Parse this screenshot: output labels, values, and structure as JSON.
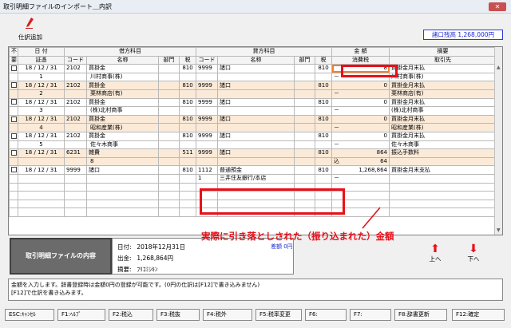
{
  "window": {
    "title": "取引明細ファイルのインポート＿内訳",
    "close_label": "✕"
  },
  "toolbar": {
    "add_label": "仕訳追加"
  },
  "balance": {
    "text": "諸口残高 1,268,000円"
  },
  "grid": {
    "header_row1": {
      "fu": "不",
      "date": "日 付",
      "debit": "借方科目",
      "credit": "貸方科目",
      "amount": "金 額",
      "memo": "摘要"
    },
    "header_row2": {
      "yo": "要",
      "voucher": "証憑",
      "d_code": "コード",
      "d_name": "名称",
      "d_dept": "部門",
      "d_tax": "税",
      "c_code": "コード",
      "c_name": "名称",
      "c_dept": "部門",
      "c_tax": "税",
      "tax_amt": "消費税",
      "partner": "取引先"
    },
    "records": [
      {
        "date": "18 / 12 / 31",
        "d_code": "2102",
        "d_name": "買掛金",
        "d_tax": "810",
        "c_code": "9999",
        "c_name": "諸口",
        "c_tax": "810",
        "amount": "8",
        "memo": "買掛金月末払",
        "voucher": "1",
        "d_sub": "川村商事(株)",
        "tax_flag": "－",
        "tax_amt": "",
        "partner": "川村商事(株)"
      },
      {
        "date": "18 / 12 / 31",
        "d_code": "2102",
        "d_name": "買掛金",
        "d_tax": "810",
        "c_code": "9999",
        "c_name": "諸口",
        "c_tax": "810",
        "amount": "0",
        "memo": "買掛金月末払",
        "voucher": "2",
        "d_sub": "栗林商店(有)",
        "tax_flag": "－",
        "tax_amt": "",
        "partner": "栗林商店(有)"
      },
      {
        "date": "18 / 12 / 31",
        "d_code": "2102",
        "d_name": "買掛金",
        "d_tax": "810",
        "c_code": "9999",
        "c_name": "諸口",
        "c_tax": "810",
        "amount": "0",
        "memo": "買掛金月末払",
        "voucher": "3",
        "d_sub": "(株)北村商事",
        "tax_flag": "－",
        "tax_amt": "",
        "partner": "(株)北村商事"
      },
      {
        "date": "18 / 12 / 31",
        "d_code": "2102",
        "d_name": "買掛金",
        "d_tax": "810",
        "c_code": "9999",
        "c_name": "諸口",
        "c_tax": "810",
        "amount": "0",
        "memo": "買掛金月末払",
        "voucher": "4",
        "d_sub": "昭和産業(株)",
        "tax_flag": "－",
        "tax_amt": "",
        "partner": "昭和産業(株)"
      },
      {
        "date": "18 / 12 / 31",
        "d_code": "2102",
        "d_name": "買掛金",
        "d_tax": "810",
        "c_code": "9999",
        "c_name": "諸口",
        "c_tax": "810",
        "amount": "0",
        "memo": "買掛金月末払",
        "voucher": "5",
        "d_sub": "佐々木商事",
        "tax_flag": "－",
        "tax_amt": "",
        "partner": "佐々木商事"
      },
      {
        "date": "18 / 12 / 31",
        "d_code": "6231",
        "d_name": "雑費",
        "d_tax": "511",
        "c_code": "9999",
        "c_name": "諸口",
        "c_tax": "810",
        "amount": "864",
        "memo": "振込手数料",
        "voucher": "",
        "d_sub": "8",
        "tax_flag": "込",
        "tax_amt": "64",
        "partner": ""
      },
      {
        "date": "18 / 12 / 31",
        "d_code": "9999",
        "d_name": "諸口",
        "d_tax": "810",
        "c_code": "1112",
        "c_name": "普通預金",
        "c_tax": "810",
        "amount": "1,268,864",
        "memo": "買掛金月末支払",
        "voucher": "",
        "d_sub": "",
        "c_sub_code": "1",
        "c_sub": "三井住友銀行/本店",
        "tax_flag": "－",
        "tax_amt": "",
        "partner": ""
      }
    ]
  },
  "annotation": {
    "text": "実際に引き落としされた（振り込まれた）金額"
  },
  "content_panel": {
    "label": "取引明細ファイルの内容"
  },
  "info": {
    "date_key": "日付:",
    "date_val": "2018年12月31日",
    "out_key": "出金:",
    "out_val": "1,268,864円",
    "memo_key": "摘要:",
    "memo_val": "ﾌﾘｺﾐｼｷﾝ",
    "tail": "差額 0円"
  },
  "nav": {
    "up_label": "上へ",
    "down_label": "下へ"
  },
  "message": {
    "line1": "金額を入力します。辞書登録時は金額0円の登録が可能です。(0円の仕訳は[F12]で書き込みません)",
    "line2": "[F12]で仕訳を書き込みます。"
  },
  "fkeys": [
    "ESC:ｷｬﾝｾﾙ",
    "F1:ﾍﾙﾌﾟ",
    "F2:税込",
    "F3:税抜",
    "F4:税外",
    "F5:税率変更",
    "F6:",
    "F7:",
    "F8:辞書更新",
    "F12:確定"
  ],
  "colors": {
    "accent_red": "#e8101a",
    "row_alt": "#fbead8",
    "balance_blue": "#1a2ad0"
  }
}
